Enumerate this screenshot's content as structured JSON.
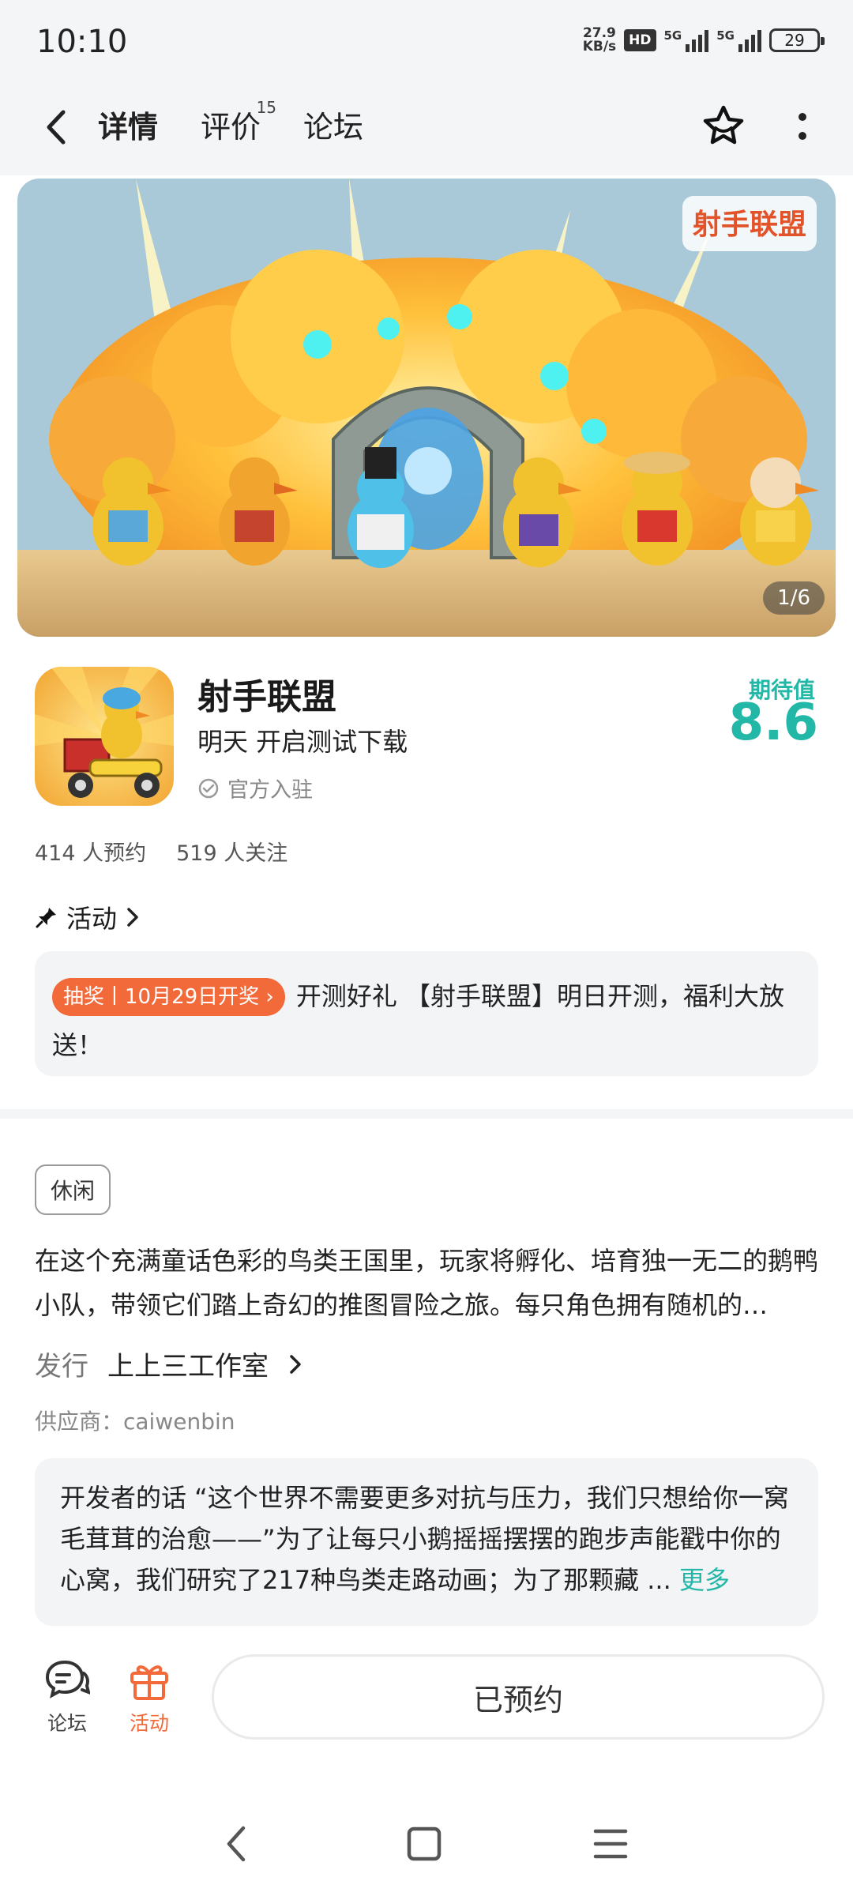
{
  "status_bar": {
    "time": "10:10",
    "net_speed_value": "27.9",
    "net_speed_unit": "KB/s",
    "hd_badge": "HD",
    "signal_1": "5G",
    "signal_2": "5G",
    "battery": "29"
  },
  "header": {
    "tabs": [
      {
        "label": "详情",
        "badge": ""
      },
      {
        "label": "评价",
        "badge": "15"
      },
      {
        "label": "论坛",
        "badge": ""
      }
    ],
    "accent": "#2cd0c0"
  },
  "banner": {
    "logo_text": "射手联盟",
    "pager": "1/6"
  },
  "app": {
    "name": "射手联盟",
    "subtitle": "明天 开启测试下载",
    "official": "官方入驻",
    "expect_label": "期待值",
    "expect_score": "8.6",
    "reservations": "414 人预约",
    "followers": "519 人关注"
  },
  "activity": {
    "title": "活动",
    "badge": "抽奖丨10月29日开奖",
    "text": "开测好礼 【射手联盟】明日开测，福利大放送！",
    "badge_color": "#f26a3a"
  },
  "details": {
    "tag": "休闲",
    "description": "在这个充满童话色彩的鸟类王国里，玩家将孵化、培育独一无二的鹅鸭小队，带领它们踏上奇幻的推图冒险之旅。每只角色拥有随机的…",
    "publisher_label": "发行",
    "publisher_value": "上上三工作室",
    "supplier": "供应商：caiwenbin",
    "dev_words": "开发者的话 “这个世界不需要更多对抗与压力，我们只想给你一窝毛茸茸的治愈——”为了让每只小鹅摇摇摆摆的跑步声能戳中你的心窝，我们研究了217种鸟类走路动画；为了那颗藏 ...",
    "more": "更多"
  },
  "bottom_bar": {
    "forum": "论坛",
    "activity": "活动",
    "reserved": "已预约"
  }
}
